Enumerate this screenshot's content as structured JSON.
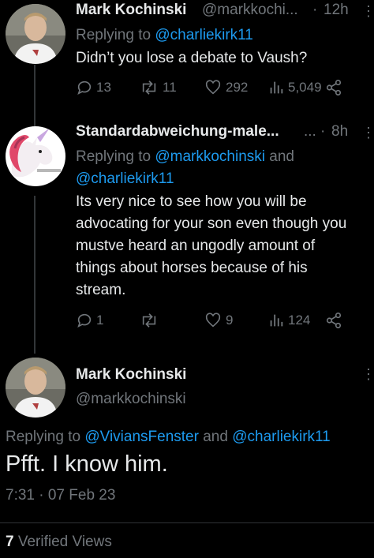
{
  "tweet1": {
    "name": "Mark Kochinski",
    "handle": "@markkochi...",
    "sep": "·",
    "time": "12h",
    "replying_prefix": "Replying to ",
    "replying_to": "@charliekirk11",
    "text": "Didn’t you lose a debate to Vaush?",
    "replies": "13",
    "retweets": "11",
    "likes": "292",
    "views": "5,049"
  },
  "tweet2": {
    "name": "Standardabweichung-male...",
    "ellipsis": "...",
    "sep": "·",
    "time": "8h",
    "replying_prefix": "Replying to ",
    "replying_to_1": "@markkochinski",
    "replying_and": " and",
    "replying_to_2": "@charliekirk11",
    "lines": [
      "Its very nice to see how you will be",
      "advocating for your son even though you",
      "mustve heard an ungodly amount of",
      "things about horses because of his",
      "stream."
    ],
    "replies": "1",
    "retweets": "",
    "likes": "9",
    "views": "124"
  },
  "main": {
    "name": "Mark Kochinski",
    "handle": "@markkochinski",
    "replying_prefix": "Replying to ",
    "replying_to_1": "@ViviansFenster",
    "replying_and": " and ",
    "replying_to_2": "@charliekirk11",
    "text": "Pfft. I know him.",
    "timestamp": "7:31 · 07 Feb 23",
    "views_count": "7",
    "views_label": " Verified Views"
  },
  "colors": {
    "background": "#000000",
    "text": "#e7e9ea",
    "muted": "#71767b",
    "link": "#1d9bf0"
  }
}
